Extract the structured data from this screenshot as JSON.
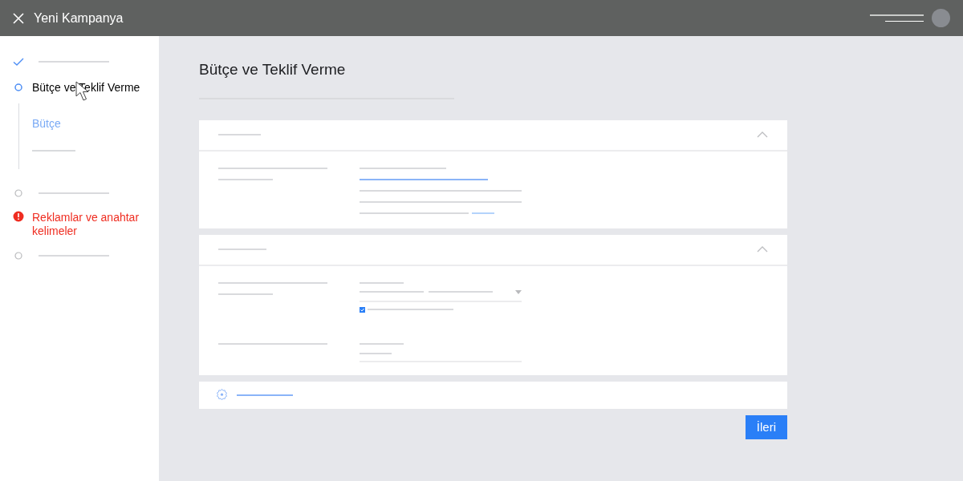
{
  "header": {
    "title": "Yeni Kampanya"
  },
  "steps": [
    {
      "kind": "done"
    },
    {
      "kind": "current",
      "label": "Bütçe ve Teklif Verme",
      "substeps": [
        {
          "label": "Bütçe",
          "selected": true
        },
        {
          "selected": false
        }
      ]
    },
    {
      "kind": "pending"
    },
    {
      "kind": "error",
      "label": "Reklamlar ve anahtar kelimeler"
    },
    {
      "kind": "pending"
    }
  ],
  "page_title": "Bütçe ve Teklif Verme",
  "sections": [
    {
      "kind": "budget",
      "expanded": true
    },
    {
      "kind": "bidding",
      "expanded": true,
      "checkbox": {
        "checked": true
      }
    },
    {
      "kind": "settings"
    }
  ],
  "next_button": {
    "label": "İleri"
  }
}
